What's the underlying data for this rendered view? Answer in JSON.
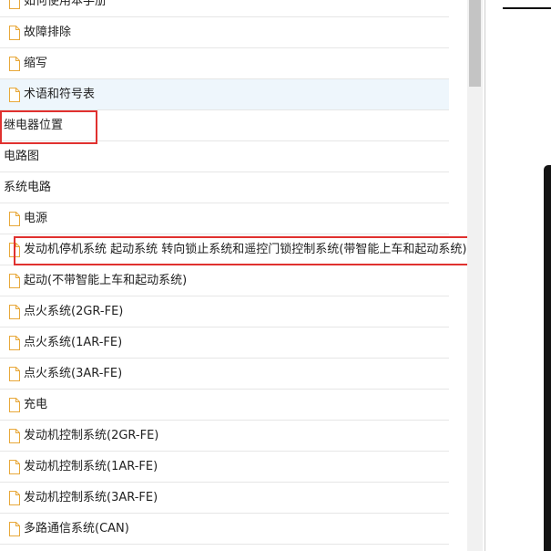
{
  "tree": {
    "items": [
      {
        "type": "doc",
        "label": "如何使用本手册",
        "highlight": false
      },
      {
        "type": "doc",
        "label": "故障排除",
        "highlight": false
      },
      {
        "type": "doc",
        "label": "缩写",
        "highlight": false
      },
      {
        "type": "doc",
        "label": "术语和符号表",
        "highlight": true
      },
      {
        "type": "category",
        "label": "继电器位置",
        "highlight": false
      },
      {
        "type": "category",
        "label": "电路图",
        "highlight": false
      },
      {
        "type": "category",
        "label": "系统电路",
        "highlight": false
      },
      {
        "type": "doc",
        "label": "电源",
        "highlight": false
      },
      {
        "type": "doc",
        "label": "发动机停机系统 起动系统 转向锁止系统和遥控门锁控制系统(带智能上车和起动系统)",
        "highlight": false
      },
      {
        "type": "doc",
        "label": "起动(不带智能上车和起动系统)",
        "highlight": false
      },
      {
        "type": "doc",
        "label": "点火系统(2GR-FE)",
        "highlight": false
      },
      {
        "type": "doc",
        "label": "点火系统(1AR-FE)",
        "highlight": false
      },
      {
        "type": "doc",
        "label": "点火系统(3AR-FE)",
        "highlight": false
      },
      {
        "type": "doc",
        "label": "充电",
        "highlight": false
      },
      {
        "type": "doc",
        "label": "发动机控制系统(2GR-FE)",
        "highlight": false
      },
      {
        "type": "doc",
        "label": "发动机控制系统(1AR-FE)",
        "highlight": false
      },
      {
        "type": "doc",
        "label": "发动机控制系统(3AR-FE)",
        "highlight": false
      },
      {
        "type": "doc",
        "label": "多路通信系统(CAN)",
        "highlight": false
      }
    ]
  },
  "annotations": {
    "color": "#e0312f",
    "marked_items": [
      4,
      8
    ]
  },
  "colors": {
    "highlight_bg": "#eef6fc",
    "row_border": "#e6e6e6",
    "icon_stroke": "#e8a83a"
  }
}
